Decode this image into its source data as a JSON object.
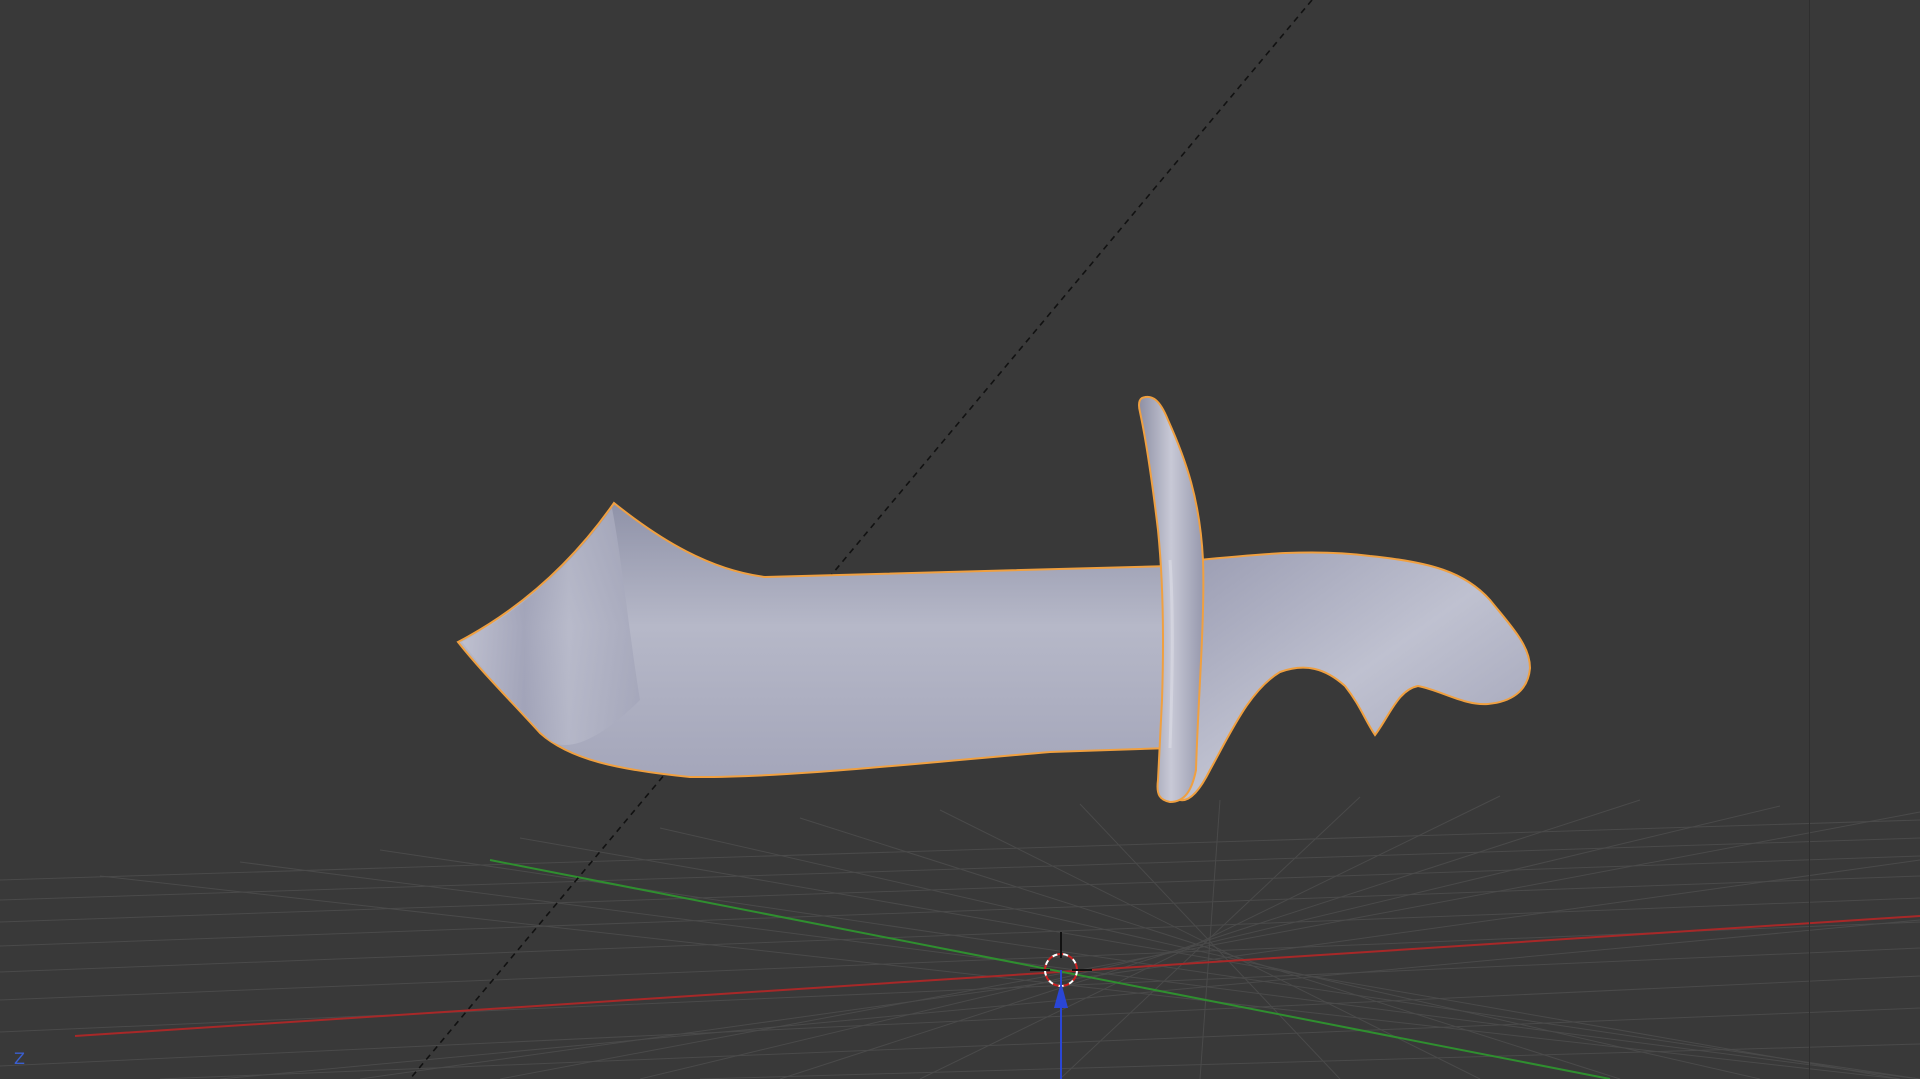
{
  "viewport": {
    "background_color": "#393939",
    "grid_color": "#4a4a4a",
    "x_axis_color": "#b02020",
    "y_axis_color": "#2f9a2f",
    "z_axis_color": "#1f3fd0",
    "selection_outline_color": "#f0a040",
    "mesh_color": "#a9abbf"
  },
  "objects": [
    {
      "name": "knife-mesh",
      "selected": true
    }
  ],
  "axis_indicator": {
    "label": "Z",
    "color": "#3a5fd0"
  },
  "icons": {
    "cursor": "3d-cursor-icon",
    "origin_arrow": "z-arrow-icon"
  }
}
